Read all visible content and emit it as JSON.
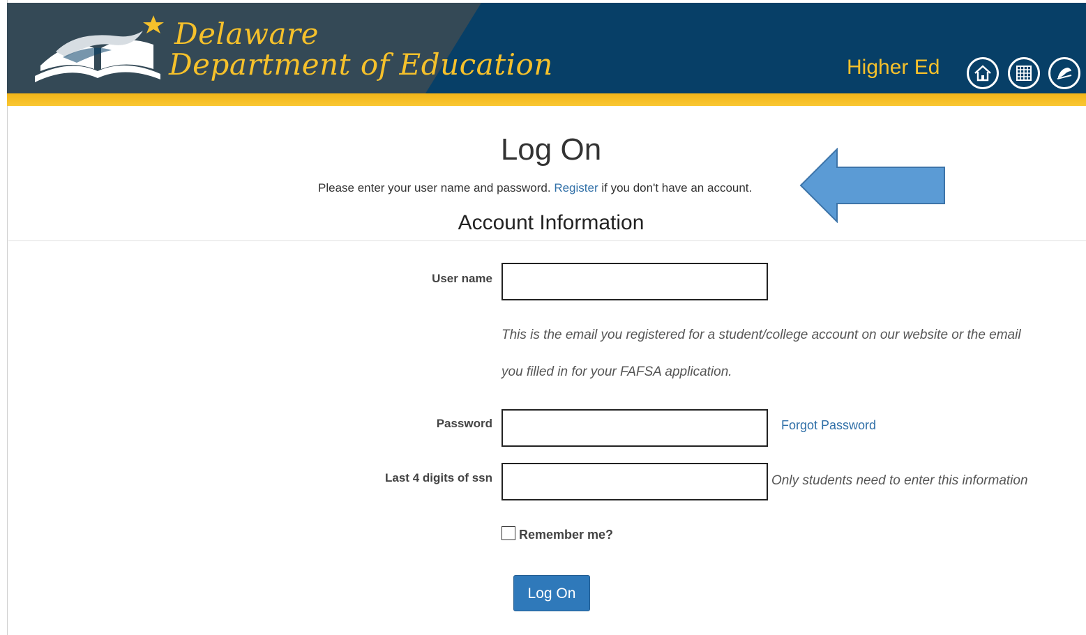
{
  "header": {
    "brand_line1": "Delaware",
    "brand_line2": "Department of Education",
    "higher_ed": "Higher Ed",
    "icons": [
      "home-icon",
      "calendar-grid-icon",
      "delaware-map-icon"
    ],
    "colors": {
      "navy": "#073f67",
      "gold": "#f6c12b",
      "bar": "#f2b418"
    }
  },
  "login": {
    "title": "Log On",
    "intro_before": "Please enter your user name and password.",
    "register_link": "Register",
    "intro_after": "if you don't have an account.",
    "section_title": "Account Information",
    "username_label": "User name",
    "username_value": "",
    "username_hint_line1": "This is the email you registered for a student/college account on our website or the email",
    "username_hint_line2": "you filled in for your FAFSA application.",
    "password_label": "Password",
    "password_value": "",
    "forgot_password": "Forgot Password",
    "ssn_label": "Last 4 digits of ssn",
    "ssn_value": "",
    "ssn_hint": "Only students need to enter this information",
    "remember_label": "Remember me?",
    "remember_checked": false,
    "submit_label": "Log On",
    "accent_color": "#2f79ba",
    "annotation_arrow_color": "#5b9bd5"
  }
}
